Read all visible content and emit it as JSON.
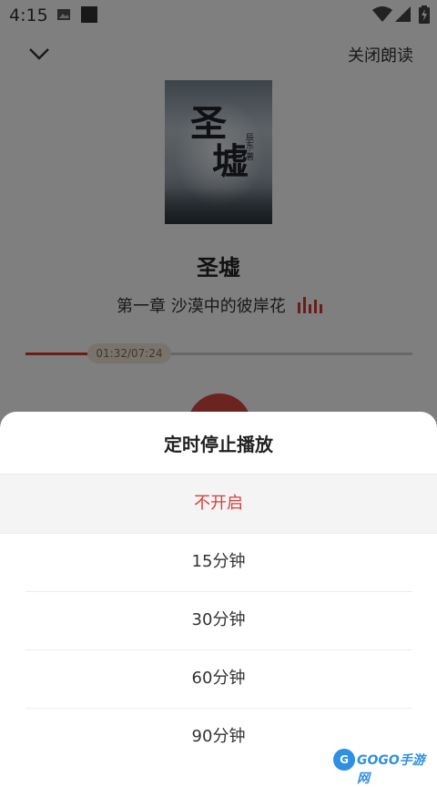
{
  "status_bar": {
    "time": "4:15"
  },
  "header": {
    "close_label": "关闭朗读"
  },
  "book": {
    "title": "圣墟",
    "cover_calligraphy_1": "圣",
    "cover_calligraphy_2": "墟",
    "cover_author": "辰东·著",
    "chapter": "第一章 沙漠中的彼岸花"
  },
  "player": {
    "elapsed": "01:32",
    "duration": "07:24",
    "position_text": "01:32/07:24",
    "progress": 0.207
  },
  "timer_sheet": {
    "title": "定时停止播放",
    "options": [
      "不开启",
      "15分钟",
      "30分钟",
      "60分钟",
      "90分钟"
    ],
    "selected_index": 0
  },
  "watermark": {
    "text": "GOGO手游网"
  },
  "colors": {
    "accent": "#d3413a",
    "pill_bg": "#f3e6da",
    "pill_text": "#8a6c55"
  }
}
